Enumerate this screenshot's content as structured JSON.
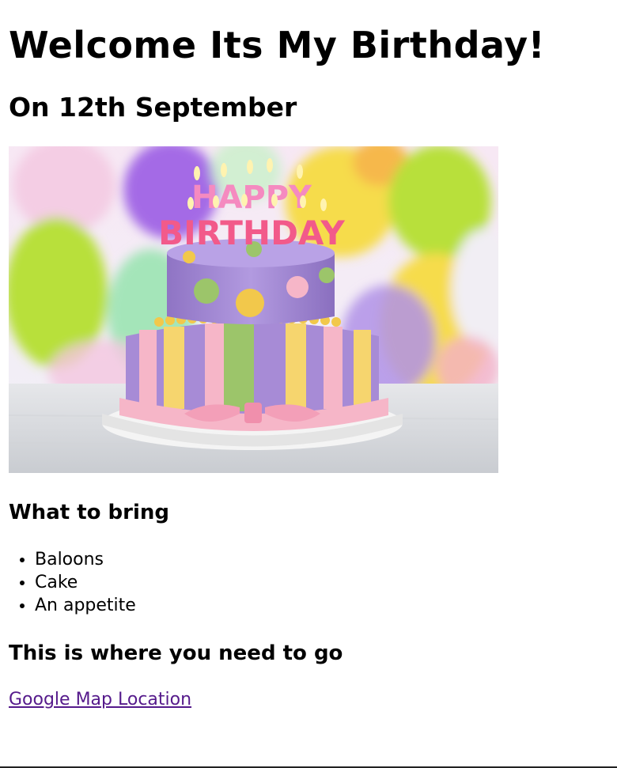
{
  "page": {
    "heading": "Welcome Its My Birthday!",
    "subheading": "On 12th September"
  },
  "photo": {
    "cake_text_top": "HAPPY",
    "cake_text_bottom": "BIRTHDAY"
  },
  "bring": {
    "title": "What to bring",
    "items": [
      {
        "label": "Baloons"
      },
      {
        "label": "Cake"
      },
      {
        "label": "An appetite"
      }
    ]
  },
  "location": {
    "title": "This is where you need to go",
    "link_label": "Google Map Location"
  },
  "colors": {
    "link_visited": "#551a8b",
    "balloon_purple": "#a46be6",
    "balloon_green": "#b8e03a",
    "balloon_yellow": "#f6dc4c",
    "cake_purple": "#a78bd6",
    "ribbon_pink": "#f6b6c8"
  }
}
